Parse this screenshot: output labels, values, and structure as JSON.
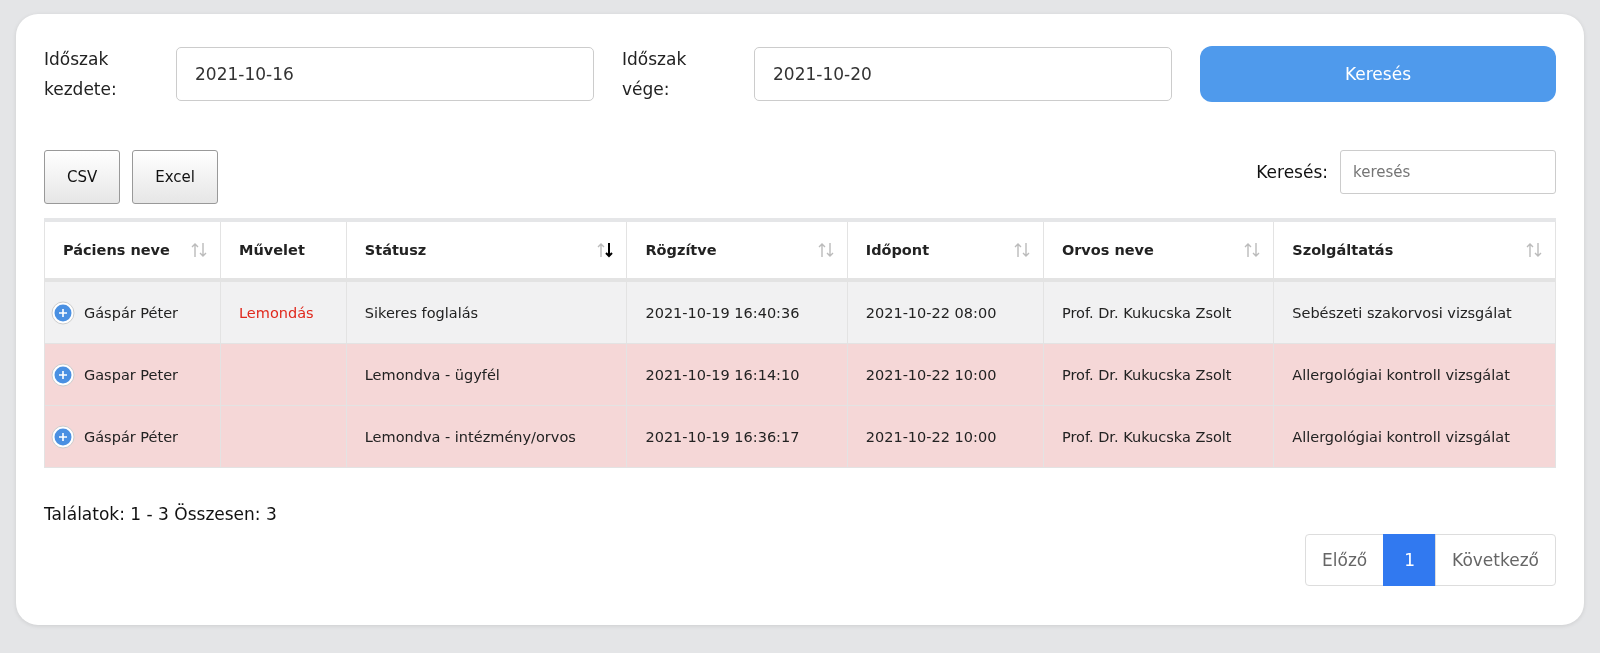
{
  "filters": [
    {
      "label": "Időszak kezdete:",
      "value": "2021-10-16"
    },
    {
      "label": "Időszak vége:",
      "value": "2021-10-20"
    }
  ],
  "search_button": "Keresés",
  "export_buttons": [
    "CSV",
    "Excel"
  ],
  "table_search": {
    "label": "Keresés:",
    "placeholder": "keresés"
  },
  "table": {
    "columns": [
      {
        "label": "Páciens neve",
        "sortable": true,
        "sorted_descending": false
      },
      {
        "label": "Művelet",
        "sortable": false
      },
      {
        "label": "Státusz",
        "sortable": true,
        "sorted_descending": true
      },
      {
        "label": "Rögzítve",
        "sortable": true,
        "sorted_descending": false
      },
      {
        "label": "Időpont",
        "sortable": true,
        "sorted_descending": false
      },
      {
        "label": "Orvos neve",
        "sortable": true,
        "sorted_descending": false
      },
      {
        "label": "Szolgáltatás",
        "sortable": true,
        "sorted_descending": false
      }
    ],
    "rows": [
      {
        "kind": "active",
        "patient": "Gáspár Péter",
        "action": "Lemondás",
        "status": "Sikeres foglalás",
        "recorded": "2021-10-19 16:40:36",
        "appointment": "2021-10-22 08:00",
        "doctor": "Prof. Dr. Kukucska Zsolt",
        "service": "Sebészeti szakorvosi vizsgálat"
      },
      {
        "kind": "cancelled",
        "patient": "Gaspar Peter",
        "status": "Lemondva - ügyfél",
        "recorded": "2021-10-19 16:14:10",
        "appointment": "2021-10-22 10:00",
        "doctor": "Prof. Dr. Kukucska Zsolt",
        "service": "Allergológiai kontroll vizsgálat"
      },
      {
        "kind": "cancelled",
        "patient": "Gáspár Péter",
        "status": "Lemondva - intézmény/orvos",
        "recorded": "2021-10-19 16:36:17",
        "appointment": "2021-10-22 10:00",
        "doctor": "Prof. Dr. Kukucska Zsolt",
        "service": "Allergológiai kontroll vizsgálat"
      }
    ]
  },
  "summary": "Találatok: 1 - 3 Összesen: 3",
  "pagination": [
    {
      "label": "Előző",
      "selected": false
    },
    {
      "label": "1",
      "selected": true
    },
    {
      "label": "Következő",
      "selected": false
    }
  ]
}
